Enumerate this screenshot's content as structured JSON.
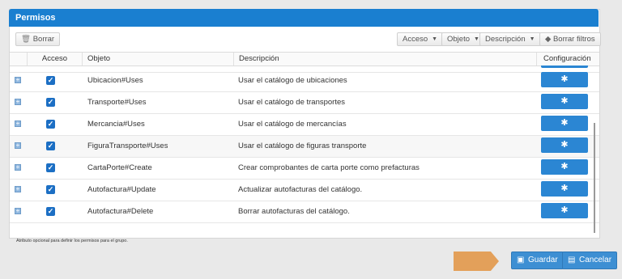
{
  "panel": {
    "title": "Permisos"
  },
  "toolbar": {
    "delete_label": "Borrar",
    "filter_access": "Acceso",
    "filter_object": "Objeto",
    "filter_description": "Descripción",
    "clear_filters": "Borrar filtros"
  },
  "columns": {
    "access": "Acceso",
    "object": "Objeto",
    "description": "Descripción",
    "configuration": "Configuración"
  },
  "rows": [
    {
      "object": "Ubicacion#Uses",
      "description": "Usar el catálogo de ubicaciones",
      "checked": true
    },
    {
      "object": "Transporte#Uses",
      "description": "Usar el catálogo de transportes",
      "checked": true
    },
    {
      "object": "Mercancia#Uses",
      "description": "Usar el catálogo de mercancías",
      "checked": true
    },
    {
      "object": "FiguraTransporte#Uses",
      "description": "Usar el catálogo de figuras transporte",
      "checked": true
    },
    {
      "object": "CartaPorte#Create",
      "description": "Crear comprobantes de carta porte como prefacturas",
      "checked": true
    },
    {
      "object": "Autofactura#Update",
      "description": "Actualizar autofacturas del catálogo.",
      "checked": true
    },
    {
      "object": "Autofactura#Delete",
      "description": "Borrar autofacturas del catálogo.",
      "checked": true
    }
  ],
  "footnote": "Atributo opcional para definir los permisos para el grupo.",
  "actions": {
    "save": "Guardar",
    "cancel": "Cancelar"
  },
  "icons": {
    "trash": "trash-icon",
    "eraser": "eraser-icon",
    "gear": "gear-icon",
    "save": "floppy-icon",
    "cancel": "document-icon",
    "expand": "plus-square-icon",
    "check": "checkbox-icon"
  },
  "colors": {
    "header": "#1a7fd0",
    "button": "#2b86d3",
    "arrow": "#e3a05a"
  }
}
